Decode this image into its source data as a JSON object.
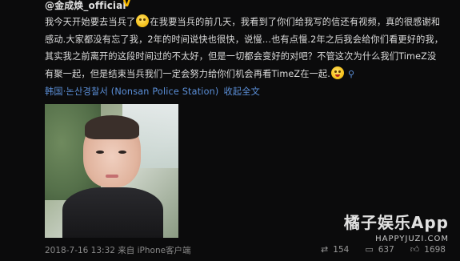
{
  "post": {
    "username": "@金成焕_official",
    "verified_badge": "V",
    "content_part1": "我今天开始要去当兵了",
    "content_part2": "在我要当兵的前几天，我看到了你们给我写的信还有视频，真的很感谢和感动.大家都没有忘了我，2年的时间说快也很快，说慢…也有点慢.2年之后我会给你们看更好的我，其实我之前离开的这段时间过的不太好，但是一切都会变好的对吧？不管这次为什么我们TimeZ没有聚一起，但是结束当兵我们一定会努力给你们机会再看TimeZ在一起.",
    "location": "韩国·논산경찰서 (Nonsan Police Station)",
    "collapse_label": "收起全文",
    "date": "2018-7-16 13:32",
    "source": "来自 iPhone客户端",
    "stats": {
      "reposts": "154",
      "comments": "637",
      "likes": "1698"
    }
  },
  "watermark": {
    "title": "橘子娱乐App",
    "url": "HAPPYJUZI.COM"
  },
  "icons": {
    "emoji_1": "sad-face-emoji",
    "emoji_2": "tongue-face-emoji",
    "location": "location-pin-icon",
    "repost": "repost-icon",
    "comment": "comment-icon",
    "like": "thumbs-up-icon"
  }
}
